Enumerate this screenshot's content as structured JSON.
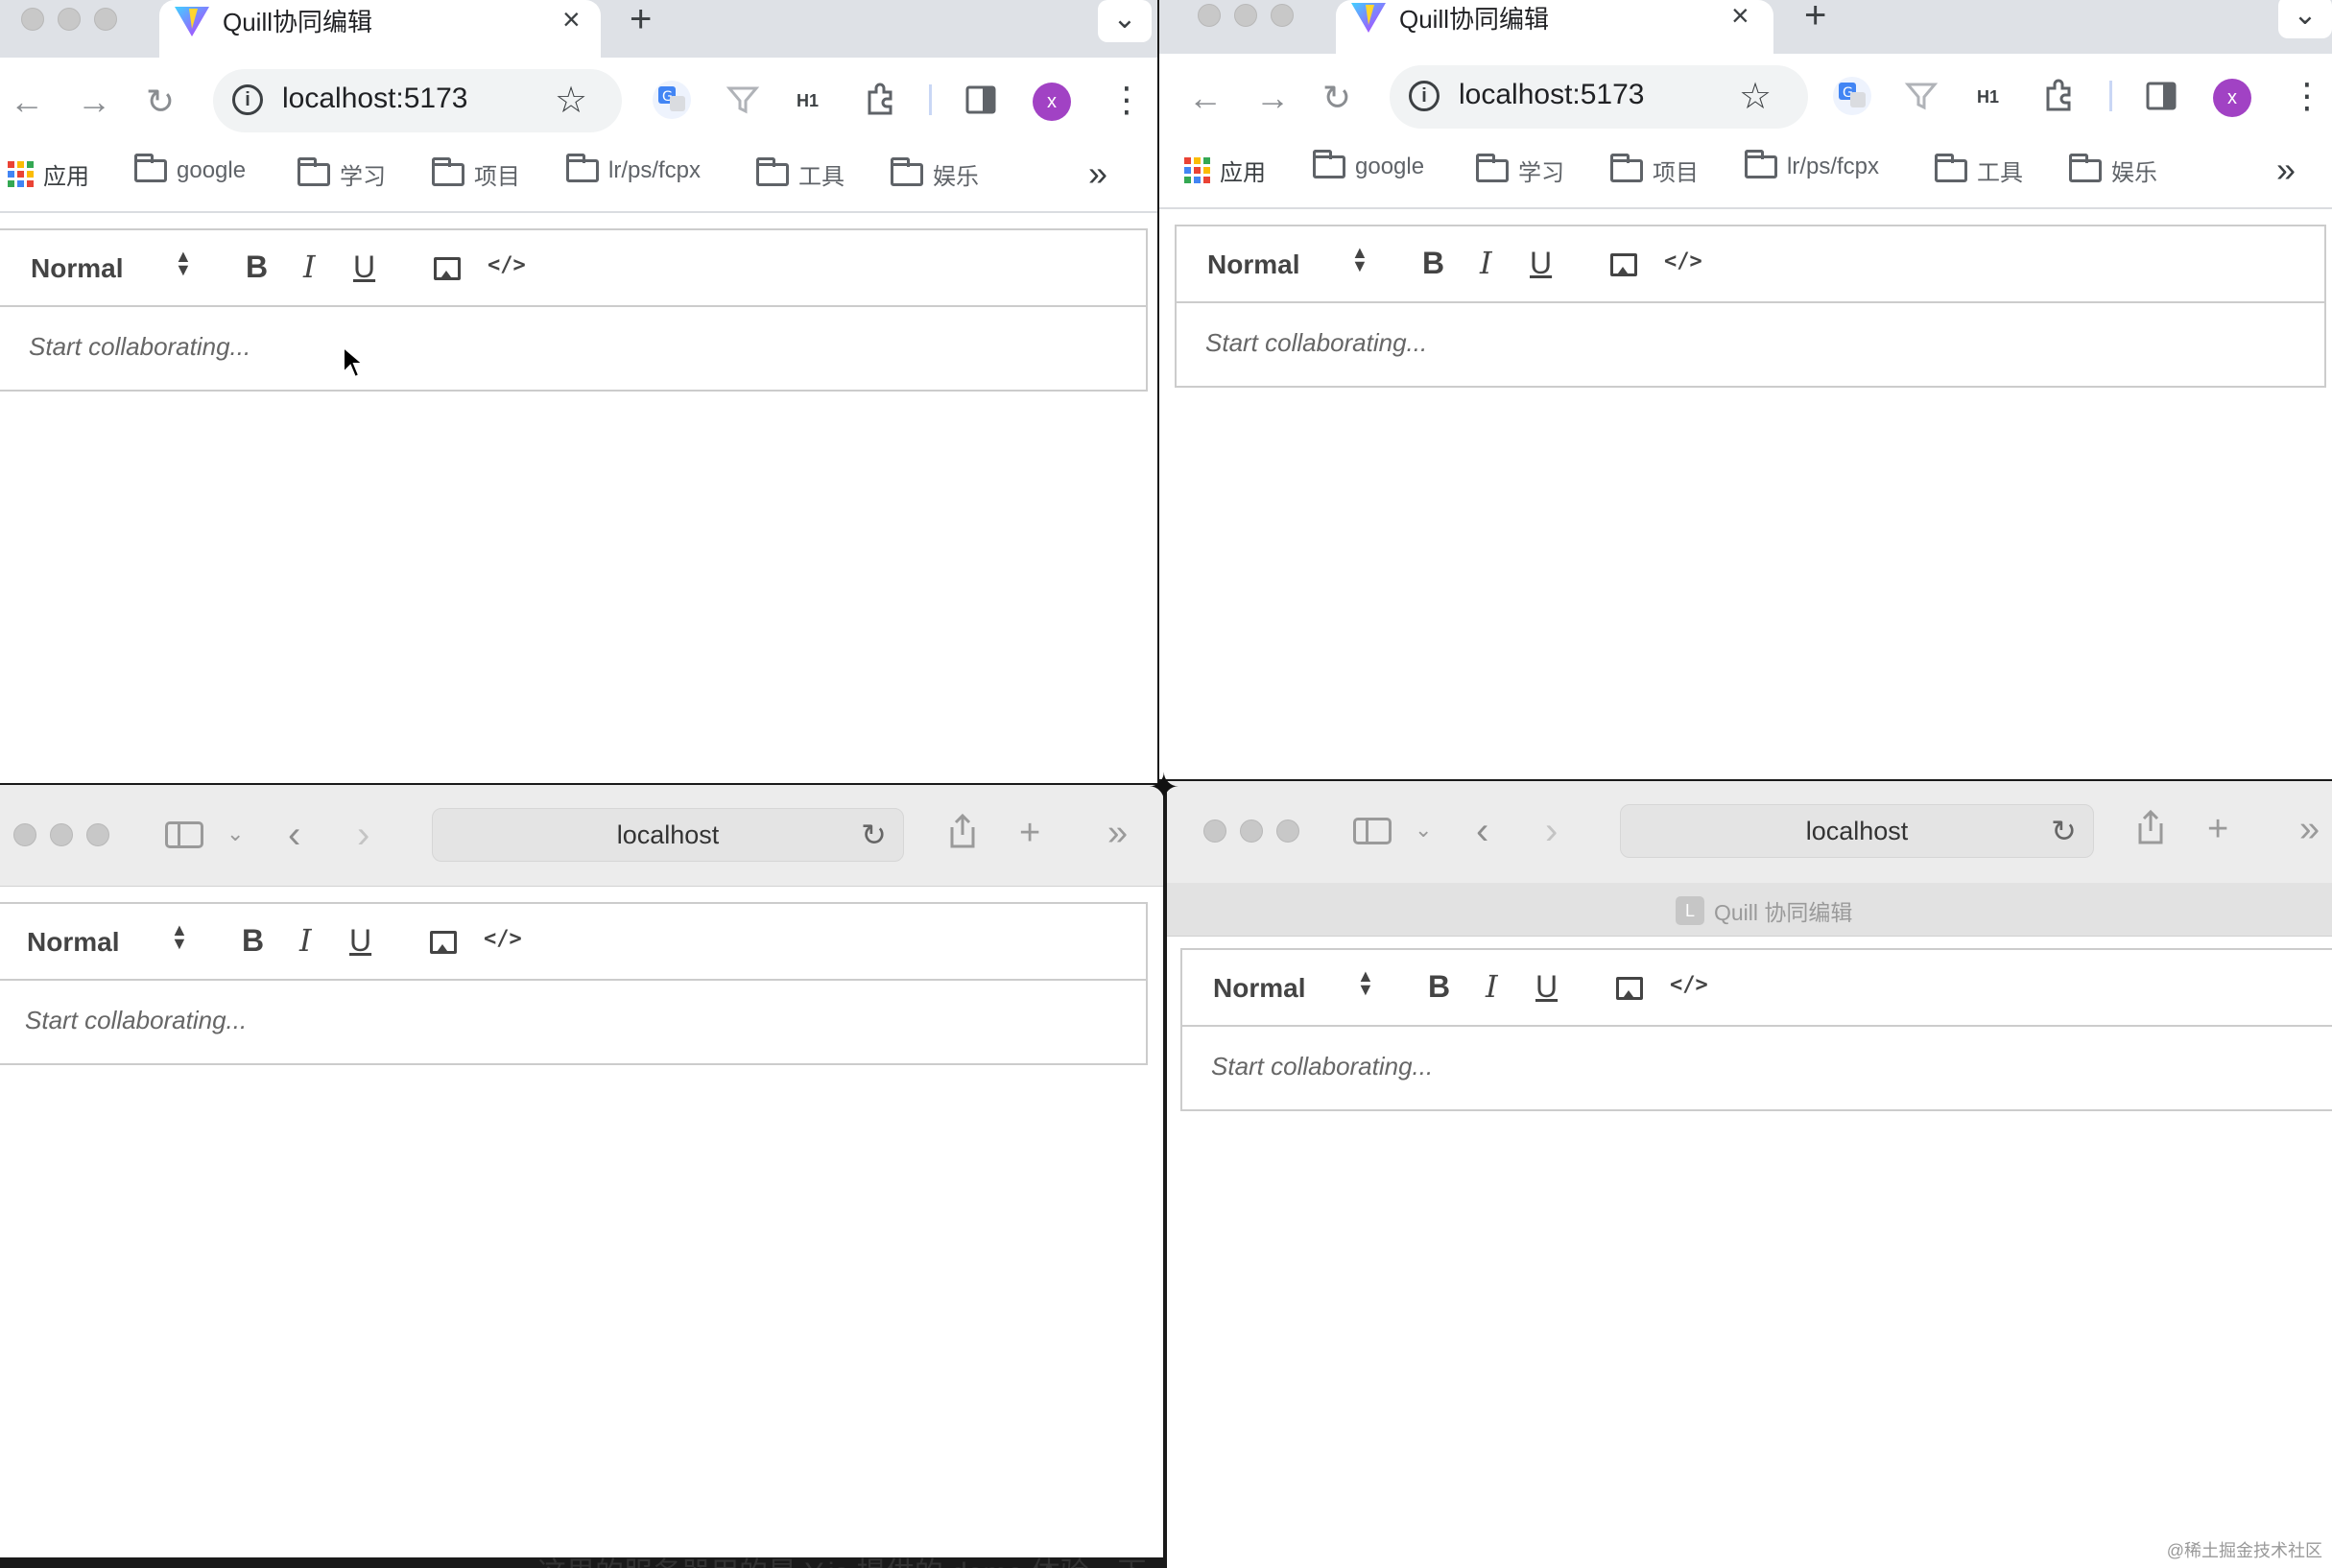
{
  "chrome": {
    "tab_title": "Quill协同编辑",
    "url": "localhost:5173",
    "avatar_letter": "x",
    "extension_h1": "H1",
    "bookmarks": [
      "应用",
      "google",
      "学习",
      "项目",
      "lr/ps/fcpx",
      "工具",
      "娱乐"
    ]
  },
  "safari": {
    "url": "localhost",
    "tab_title": "Quill 协同编辑",
    "tab_favicon_letter": "L"
  },
  "editor": {
    "format_picker": "Normal",
    "bold": "B",
    "italic": "I",
    "underline": "U",
    "code": "</>",
    "placeholder": "Start collaborating..."
  },
  "overlay": {
    "subtitle": "这里的服务器用的是 Y.js 提供的 demo 体验一下",
    "watermark": "@稀土掘金技术社区"
  },
  "colors": {
    "chrome_tabbar": "#dee1e6",
    "safari_bar": "#ececec",
    "avatar": "#a142c4",
    "quill_border": "#cccccc"
  }
}
